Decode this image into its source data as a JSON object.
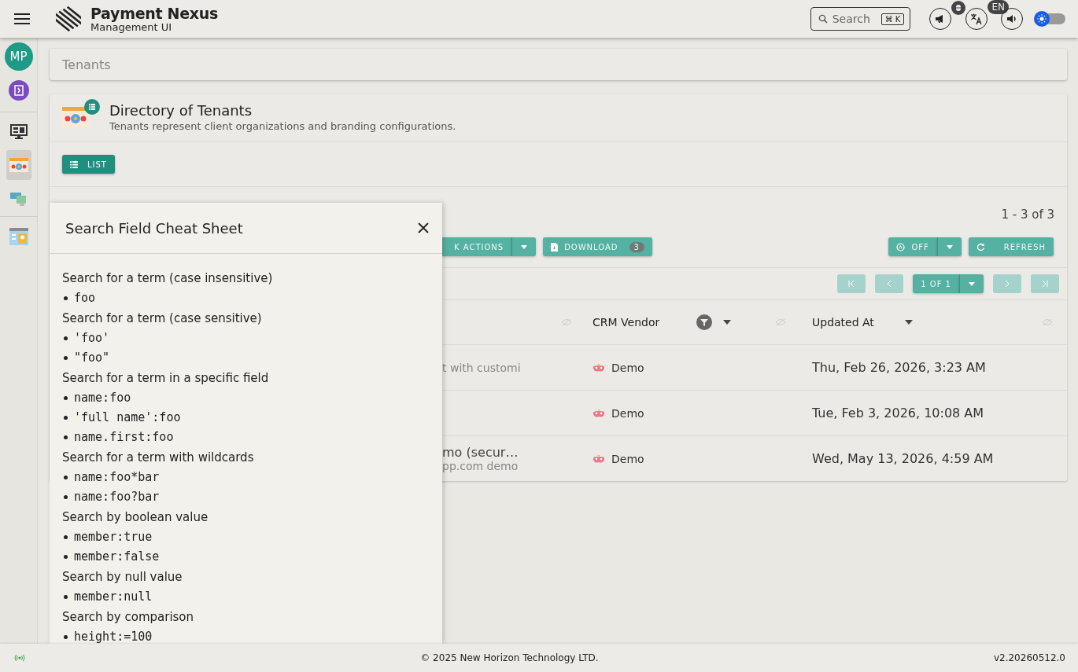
{
  "header": {
    "title": "Payment Nexus",
    "subtitle": "Management UI",
    "search": {
      "placeholder": "Search",
      "shortcut": "⌘ K"
    },
    "language_badge": "EN",
    "theme_toggle": {
      "on": false
    }
  },
  "rail": {
    "avatar": "MP",
    "nav": [
      {
        "kind": "monitor",
        "selected": false
      },
      {
        "kind": "tenants",
        "selected": true
      },
      {
        "kind": "devices",
        "selected": false
      },
      {
        "kind": "profile",
        "selected": false
      }
    ]
  },
  "breadcrumb": "Tenants",
  "directory": {
    "title": "Directory of Tenants",
    "subtitle": "Tenants represent client organizations and branding configurations.",
    "list_button": "LIST",
    "range": "1 - 3 of 3",
    "toolbar": {
      "bulk_button": "K ACTIONS",
      "download_button": "DOWNLOAD",
      "download_count": "3",
      "auto_button": "OFF",
      "refresh_button": "REFRESH"
    },
    "pager": {
      "page": "1 OF 1"
    },
    "columns": [
      "CRM Vendor",
      "Updated At"
    ],
    "rows": [
      {
        "tenant_name": "",
        "tenant_detail": "t with customi",
        "vendor": "Demo",
        "updated_at": "Thu, Feb 26, 2026, 3:23 AM"
      },
      {
        "tenant_name": "",
        "tenant_detail": "",
        "vendor": "Demo",
        "updated_at": "Tue, Feb 3, 2026, 10:08 AM"
      },
      {
        "tenant_name": "mo (secur…",
        "tenant_detail": "pp.com demo",
        "vendor": "Demo",
        "updated_at": "Wed, May 13, 2026, 4:59 AM"
      }
    ]
  },
  "cheat_sheet": {
    "title": "Search Field Cheat Sheet",
    "sections": [
      {
        "heading": "Search for a term (case insensitive)",
        "examples": [
          "foo"
        ]
      },
      {
        "heading": "Search for a term (case sensitive)",
        "examples": [
          "'foo'",
          "\"foo\""
        ]
      },
      {
        "heading": "Search for a term in a specific field",
        "examples": [
          "name:foo",
          "'full name':foo",
          "name.first:foo"
        ]
      },
      {
        "heading": "Search for a term with wildcards",
        "examples": [
          "name:foo*bar",
          "name:foo?bar"
        ]
      },
      {
        "heading": "Search by boolean value",
        "examples": [
          "member:true",
          "member:false"
        ]
      },
      {
        "heading": "Search by null value",
        "examples": [
          "member:null"
        ]
      },
      {
        "heading": "Search by comparison",
        "examples": [
          "height:=100"
        ]
      }
    ]
  },
  "footer": {
    "copyright": "© 2025 New Horizon Technology LTD.",
    "version": "v2.20260512.0"
  }
}
